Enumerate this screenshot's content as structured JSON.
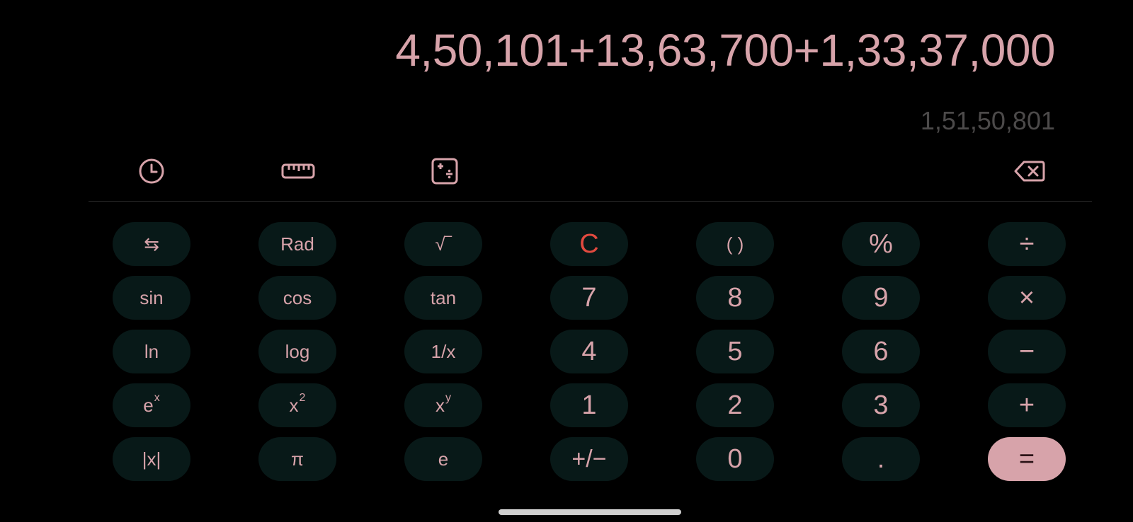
{
  "display": {
    "expression": "4,50,101+13,63,700+1,33,37,000",
    "result": "1,51,50,801"
  },
  "toolbar": {
    "history_icon": "history-clock-icon",
    "unit_converter_icon": "ruler-icon",
    "math_mode_icon": "calculator-mode-icon",
    "backspace_icon": "backspace-icon"
  },
  "keys": {
    "row1": [
      "⇆",
      "Rad",
      "√‾",
      "C",
      "( )",
      "%",
      "÷"
    ],
    "row2": [
      "sin",
      "cos",
      "tan",
      "7",
      "8",
      "9",
      "×"
    ],
    "row3": [
      "ln",
      "log",
      "1/x",
      "4",
      "5",
      "6",
      "−"
    ],
    "row4": {
      "exp_base": "e",
      "exp_sup": "x",
      "sq_base": "x",
      "sq_sup": "2",
      "pow_base": "x",
      "pow_sup": "y",
      "one": "1",
      "two": "2",
      "three": "3",
      "plus": "+"
    },
    "row5": [
      "|x|",
      "π",
      "e",
      "+/−",
      "0",
      ".",
      "="
    ]
  },
  "colors": {
    "accent": "#d7a3aa",
    "key_bg": "#081918",
    "clear": "#e24a3f",
    "result_text": "#4c4a4a",
    "background": "#000000"
  }
}
